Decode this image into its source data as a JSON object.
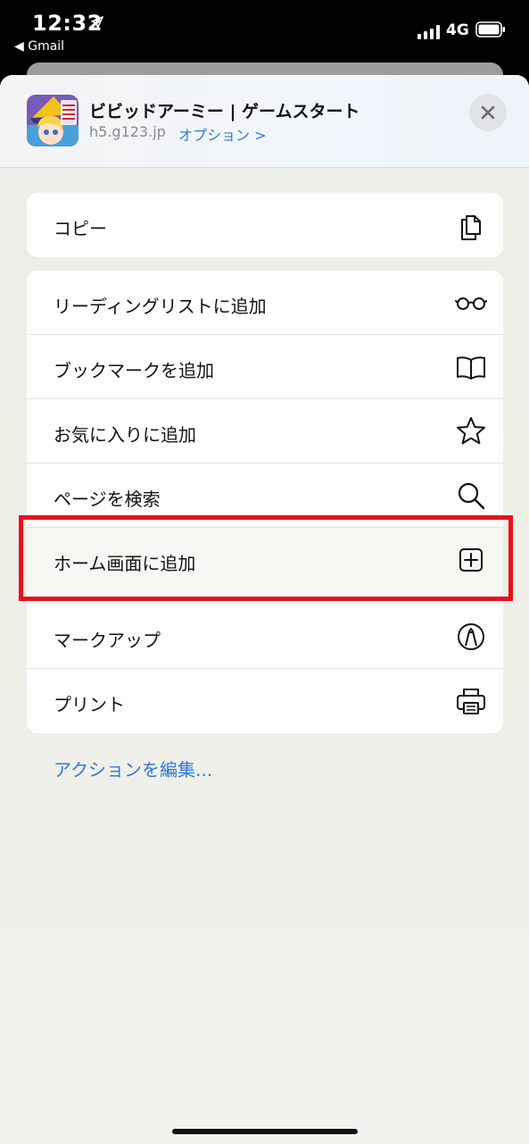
{
  "status_bar": {
    "time": "12:32",
    "back_label": "◀ Gmail",
    "network": "4G"
  },
  "sheet": {
    "title": "ビビッドアーミー | ゲームスタート",
    "domain": "h5.g123.jp",
    "options_label": "オプション >"
  },
  "actions": {
    "copy": "コピー",
    "reading_list": "リーディングリストに追加",
    "bookmark": "ブックマークを追加",
    "favorites": "お気に入りに追加",
    "find_on_page": "ページを検索",
    "add_to_home": "ホーム画面に追加",
    "markup": "マークアップ",
    "print": "プリント"
  },
  "edit_actions": "アクションを編集...",
  "icons": [
    "location-arrow-icon",
    "signal-icon",
    "battery-icon",
    "close-icon",
    "copy-icon",
    "glasses-icon",
    "book-icon",
    "star-icon",
    "search-icon",
    "plus-square-icon",
    "markup-pen-icon",
    "printer-icon"
  ],
  "colors": {
    "accent": "#2f7ad6",
    "highlight_frame": "#e8101a"
  }
}
